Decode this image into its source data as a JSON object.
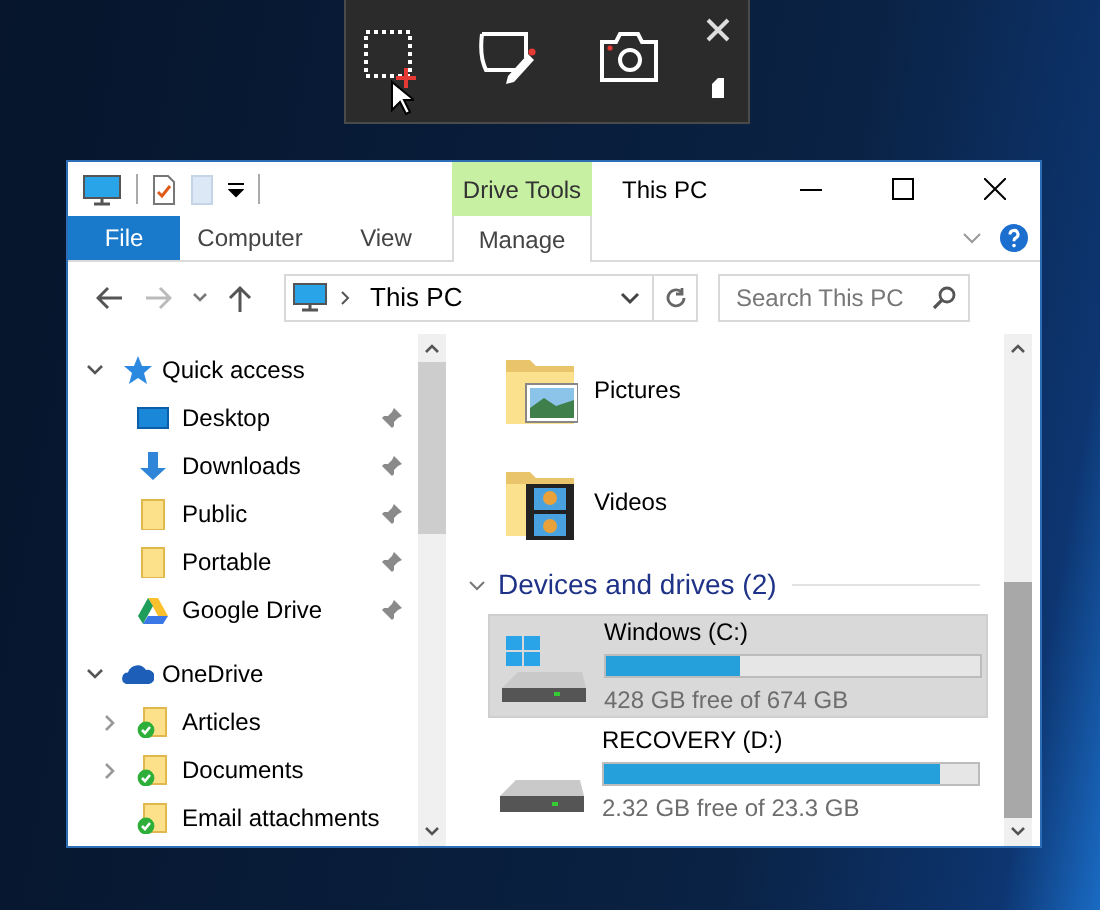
{
  "window": {
    "title": "This PC",
    "context_label": "Drive Tools"
  },
  "ribbon": {
    "tabs": [
      {
        "label": "File",
        "kind": "file"
      },
      {
        "label": "Computer",
        "kind": "normal"
      },
      {
        "label": "View",
        "kind": "normal"
      },
      {
        "label": "Manage",
        "kind": "contextual"
      }
    ]
  },
  "address_bar": {
    "path": "This PC"
  },
  "search": {
    "placeholder": "Search This PC"
  },
  "navigation": [
    {
      "label": "Quick access",
      "kind": "star",
      "expanded": true,
      "pinned": false,
      "children": [
        {
          "label": "Desktop",
          "kind": "desktop",
          "pinned": true
        },
        {
          "label": "Downloads",
          "kind": "download",
          "pinned": true
        },
        {
          "label": "Public",
          "kind": "folder",
          "pinned": true
        },
        {
          "label": "Portable",
          "kind": "folder",
          "pinned": true
        },
        {
          "label": "Google Drive",
          "kind": "gdrive",
          "pinned": true
        }
      ]
    },
    {
      "label": "OneDrive",
      "kind": "cloud",
      "expanded": true,
      "pinned": false,
      "children": [
        {
          "label": "Articles",
          "kind": "synced",
          "expanded": false,
          "pinned": false
        },
        {
          "label": "Documents",
          "kind": "synced",
          "expanded": false,
          "pinned": false
        },
        {
          "label": "Email attachments",
          "kind": "synced",
          "pinned": false
        }
      ]
    }
  ],
  "folders": [
    {
      "name": "Pictures",
      "kind": "pictures"
    },
    {
      "name": "Videos",
      "kind": "videos"
    }
  ],
  "devices": {
    "title": "Devices and drives (2)",
    "expanded": true,
    "drives": [
      {
        "name": "Windows (C:)",
        "kind": "system",
        "level": 0.36,
        "free_text": "428 GB free of 674 GB",
        "selected": true
      },
      {
        "name": "RECOVERY (D:)",
        "kind": "plain",
        "level": 0.9,
        "free_text": "2.32 GB free of 23.3 GB",
        "selected": false
      }
    ]
  }
}
